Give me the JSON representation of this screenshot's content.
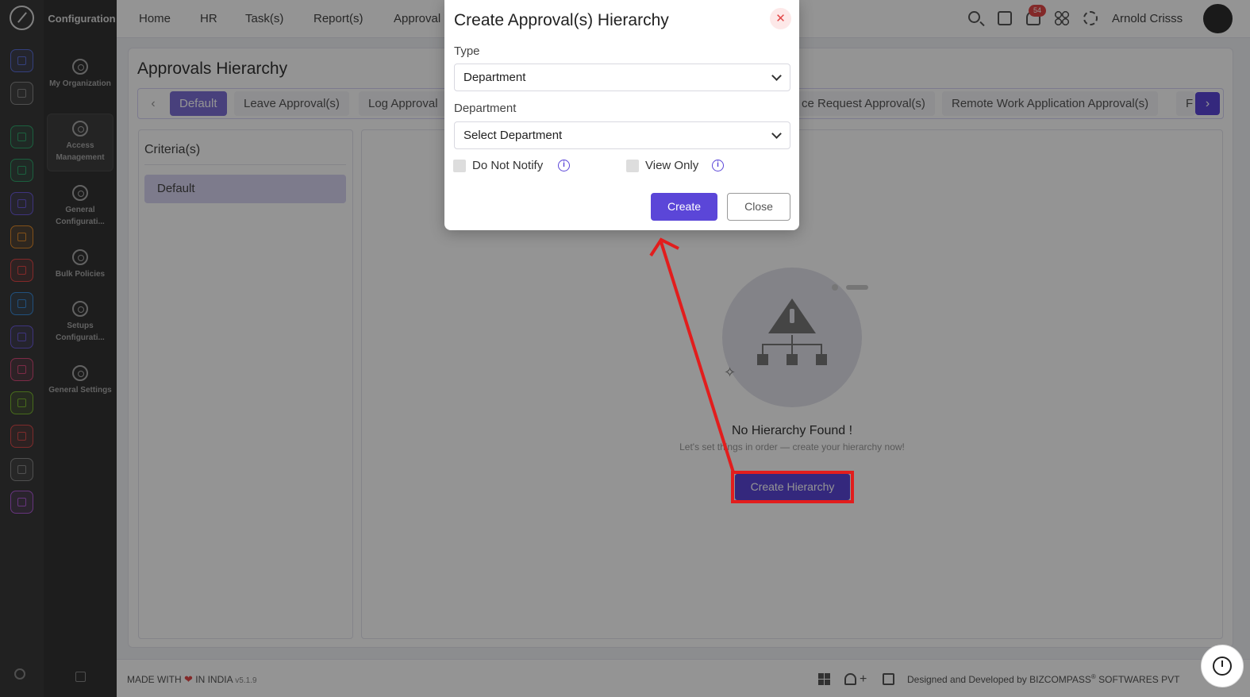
{
  "sidebar": {
    "title": "Configuration",
    "items": [
      {
        "label": "My Organization"
      },
      {
        "label": "Access Management"
      },
      {
        "label": "General Configurati..."
      },
      {
        "label": "Bulk Policies"
      },
      {
        "label": "Setups Configurati..."
      },
      {
        "label": "General Settings"
      }
    ]
  },
  "rail_colors": [
    "#5b6fd8",
    "#8a8a8a",
    "#2fa56b",
    "#2fa56b",
    "#6b5bd8",
    "#e08a2a",
    "#e24848",
    "#3a8ad8",
    "#6b5bd8",
    "#d84a7a",
    "#7ab82f",
    "#d84a4a",
    "#8a8a8a",
    "#b05bd8"
  ],
  "topnav": {
    "items": [
      "Home",
      "HR",
      "Task(s)",
      "Report(s)",
      "Approval"
    ],
    "notification_count": "54",
    "user_name": "Arnold Crisss"
  },
  "page": {
    "title": "Approvals Hierarchy",
    "tabs": [
      {
        "label": "Default"
      },
      {
        "label": "Leave Approval(s)"
      },
      {
        "label": "Log Approval"
      },
      {
        "label": "ce Request Approval(s)"
      },
      {
        "label": "Remote Work Application Approval(s)"
      },
      {
        "label": "F"
      }
    ],
    "criteria_title": "Criteria(s)",
    "criteria_items": [
      "Default"
    ],
    "empty_title": "No Hierarchy Found !",
    "empty_subtitle": "Let's set things in order — create your hierarchy now!",
    "create_hierarchy_label": "Create Hierarchy"
  },
  "footer": {
    "made_with_before": "MADE WITH",
    "made_with_after": "IN INDIA",
    "version": "v5.1.9",
    "credit_prefix": "Designed and Developed by",
    "credit_brand": "BIZCOMPASS",
    "credit_suffix": "SOFTWARES PVT"
  },
  "modal": {
    "title": "Create Approval(s) Hierarchy",
    "type_label": "Type",
    "type_value": "Department",
    "department_label": "Department",
    "department_value": "Select Department",
    "do_not_notify_label": "Do Not Notify",
    "view_only_label": "View Only",
    "create_label": "Create",
    "close_label": "Close"
  },
  "colors": {
    "accent": "#5b46d8",
    "annotation": "#e21d1d"
  }
}
